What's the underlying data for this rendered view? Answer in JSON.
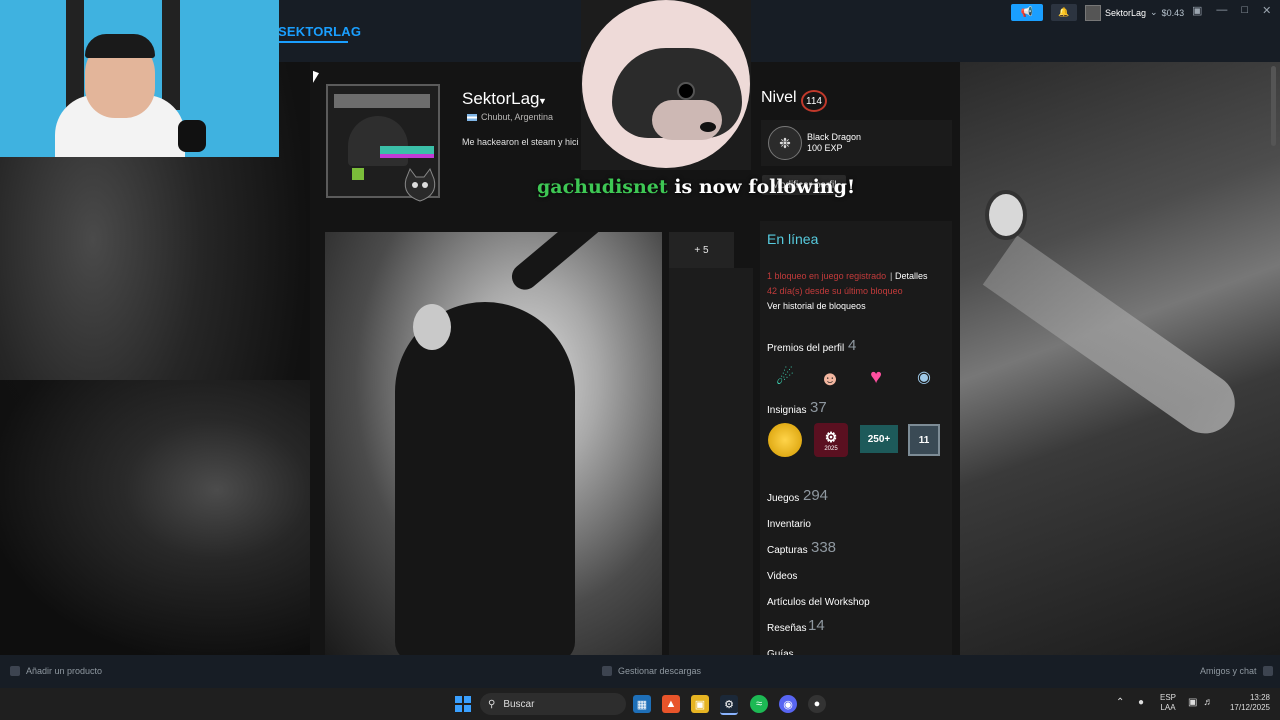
{
  "steam": {
    "nav_title": "SEKTORLAG",
    "account_name": "SektorLag",
    "wallet": "$0.43",
    "bottom_bar": {
      "add_product": "Añadir un producto",
      "downloads": "Gestionar descargas",
      "friends_chat": "Amigos y chat"
    }
  },
  "profile": {
    "persona_name": "SektorLag",
    "location": "Chubut, Argentina",
    "summary": "Me hackearon el steam y hici",
    "level_label": "Nivel",
    "level": "114",
    "featured_badge": {
      "name": "Black Dragon",
      "xp": "100 EXP"
    },
    "edit_profile": "Modificar perfil",
    "showcase_more": "+ 5",
    "status": "En línea",
    "vac": {
      "line1": "1 bloqueo en juego registrado",
      "separator": "|",
      "details": "Detalles",
      "line2": "42 día(s) desde su último bloqueo",
      "history": "Ver historial de bloqueos"
    },
    "awards": {
      "label": "Premios del perfil",
      "count": "4"
    },
    "badges": {
      "label": "Insignias",
      "count": "37",
      "tile_250": "250+",
      "tile_11": "11",
      "steam_year": "2025"
    },
    "games": {
      "label": "Juegos",
      "count": "294"
    },
    "inventory": {
      "label": "Inventario"
    },
    "screenshots": {
      "label": "Capturas",
      "count": "338"
    },
    "videos": {
      "label": "Videos"
    },
    "workshop": {
      "label": "Artículos del Workshop"
    },
    "reviews": {
      "label": "Reseñas",
      "count": "14"
    },
    "guides": {
      "label": "Guías"
    }
  },
  "overlay": {
    "follow_user": "gachudisnet",
    "follow_text": " is now following!"
  },
  "taskbar": {
    "search_placeholder": "Buscar",
    "lang_line1": "ESP",
    "lang_line2": "LAA",
    "time": "13:28",
    "date": "17/12/2025"
  },
  "colors": {
    "steam_blue": "#1a9fff",
    "online": "#57cbde",
    "vac_red": "#c23b3b",
    "follow_green": "#3ec754"
  }
}
